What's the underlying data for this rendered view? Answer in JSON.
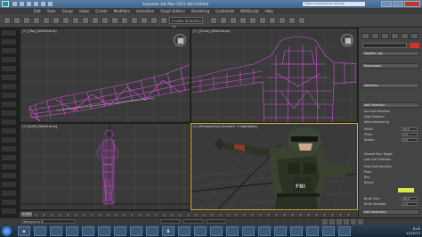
{
  "window": {
    "title": "Autodesk 3ds Max 2013 x64   Untitled",
    "search_placeholder": "Type a keyword or phrase"
  },
  "menubar": [
    "Edit",
    "Tools",
    "Group",
    "Views",
    "Create",
    "Modifiers",
    "Animation",
    "Graph Editors",
    "Rendering",
    "Customize",
    "MAXScript",
    "Help"
  ],
  "toolbar": {
    "selection_set_label": "Create Selection Se"
  },
  "viewports": {
    "top_label": "[+] [Top] [Wireframe]",
    "front_label": "[+] [Front] [Wireframe]",
    "left_label": "[+] [Left] [Wireframe]",
    "persp_label": "[+] [Perspective] [Smooth + Highlights]"
  },
  "command_panel": {
    "rollouts": [
      "Modifier List",
      "Parameters",
      "Selection",
      "Soft Selection",
      "Edit Geometry"
    ],
    "rows": [
      "Use Soft Selection",
      "Edge Distance",
      "Affect Backfacing",
      "Falloff:",
      "Pinch:",
      "Bubble:",
      "Shaded Face Toggle",
      "Lock Soft Selection",
      "Paint Soft Selection",
      "Paint",
      "Blur",
      "Revert",
      "Brush Size:",
      "Brush Strength:"
    ],
    "values": [
      "20.0",
      "0.0",
      "0.0",
      "20.0",
      "1.0"
    ]
  },
  "timeline": {
    "slider_label": "0 / 100"
  },
  "status": {
    "welcome": "Welcome to M"
  },
  "taskbar": {
    "apps": [
      "e",
      "",
      "",
      "",
      "",
      "",
      "",
      "",
      "",
      "S",
      "",
      "",
      "",
      "",
      "",
      "",
      "",
      "",
      "",
      "",
      ""
    ],
    "time": "8:40",
    "date": "4/2/2013"
  },
  "colors": {
    "wireframe": "#d94fe3",
    "viewport_bg": "#3a3a3a",
    "active_border": "#d6b43a",
    "grid": "#4e4e4e"
  }
}
